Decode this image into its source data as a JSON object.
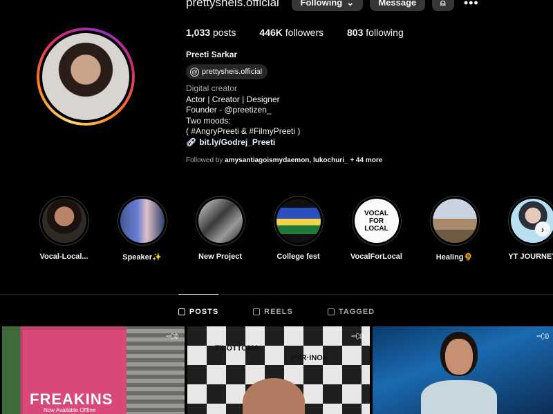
{
  "profile": {
    "username": "prettysheis.official",
    "full_name": "Preeti Sarkar",
    "threads_handle": "prettysheis.official",
    "threads_icon": "threads-icon",
    "category": "Digital creator",
    "bio_lines": [
      "Actor | Creator | Designer",
      "Founder - @preetizen_",
      "Two moods:",
      "( #AngryPreeti & #FilmyPreeti )"
    ],
    "link": "bit.ly/Godrej_Preeti"
  },
  "actions": {
    "following_label": "Following",
    "message_label": "Message"
  },
  "stats": {
    "posts_count": "1,033",
    "posts_label": "posts",
    "followers_count": "446K",
    "followers_label": "followers",
    "following_count": "803",
    "following_label": "following"
  },
  "followed_by": {
    "prefix": "Followed by",
    "names": "amysantiagoismydaemon, lukochuri_",
    "more": "+ 44 more"
  },
  "highlights": [
    {
      "label": "Vocal-Local..."
    },
    {
      "label": "Speaker✨"
    },
    {
      "label": "New Project"
    },
    {
      "label": "College fest"
    },
    {
      "label": "VocalForLocal"
    },
    {
      "label": "Healing🌻"
    },
    {
      "label": "YT JOURNEY"
    }
  ],
  "highlight_badge": {
    "line1": "VOCAL",
    "line2": "FOR",
    "line3": "LOCAL"
  },
  "tabs": [
    {
      "label": "POSTS",
      "active": true
    },
    {
      "label": "REELS",
      "active": false
    },
    {
      "label": "TAGGED",
      "active": false
    }
  ],
  "posts": {
    "post1_brand": "FREAKINS",
    "post1_sub": "Now Available Offline",
    "post2_logo_a": "TILOTTOMA",
    "post2_logo_b": "PVR·INOX"
  },
  "colors": {
    "background": "#000000",
    "button": "#363636",
    "link": "#e0f1ff",
    "muted": "#a8a8a8"
  }
}
